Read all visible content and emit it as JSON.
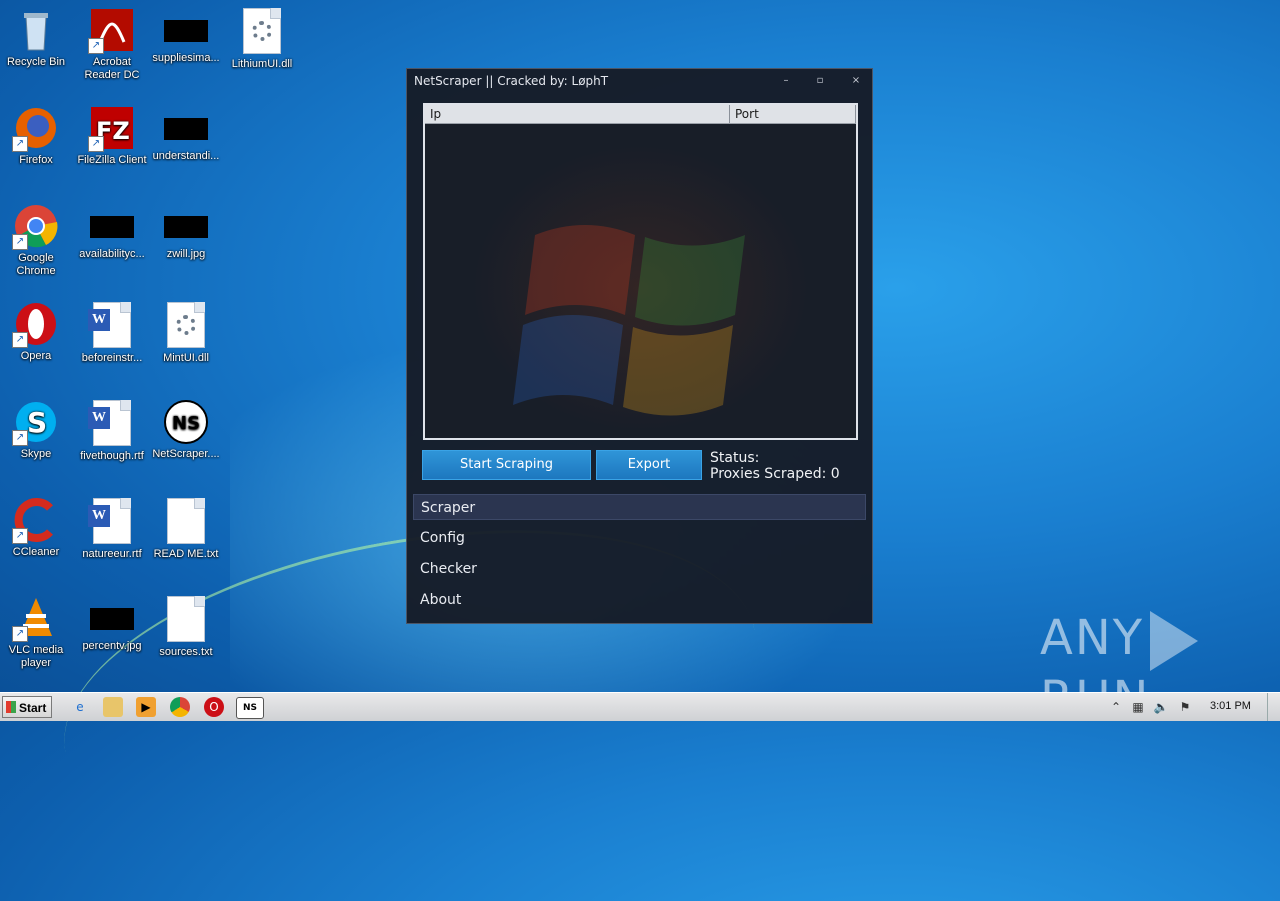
{
  "desktop": {
    "icons": [
      {
        "label": "Recycle Bin",
        "icon": "recycle-bin-icon"
      },
      {
        "label": "Acrobat\nReader DC",
        "icon": "acrobat-icon"
      },
      {
        "label": "suppliesima...",
        "icon": "redacted-image-icon"
      },
      {
        "label": "LithiumUI.dll",
        "icon": "dll-file-icon"
      },
      {
        "label": "Firefox",
        "icon": "firefox-icon"
      },
      {
        "label": "FileZilla Client",
        "icon": "filezilla-icon"
      },
      {
        "label": "understandi...",
        "icon": "redacted-image-icon"
      },
      {
        "label": "Google\nChrome",
        "icon": "chrome-icon"
      },
      {
        "label": "availabilityc...",
        "icon": "redacted-image-icon"
      },
      {
        "label": "zwill.jpg",
        "icon": "redacted-image-icon"
      },
      {
        "label": "Opera",
        "icon": "opera-icon"
      },
      {
        "label": "beforeinstr...",
        "icon": "word-doc-icon"
      },
      {
        "label": "MintUI.dll",
        "icon": "dll-file-icon"
      },
      {
        "label": "Skype",
        "icon": "skype-icon"
      },
      {
        "label": "fivethough.rtf",
        "icon": "word-doc-icon"
      },
      {
        "label": "NetScraper....",
        "icon": "netscraper-icon"
      },
      {
        "label": "CCleaner",
        "icon": "ccleaner-icon"
      },
      {
        "label": "natureeur.rtf",
        "icon": "word-doc-icon"
      },
      {
        "label": "READ ME.txt",
        "icon": "text-file-icon"
      },
      {
        "label": "VLC media\nplayer",
        "icon": "vlc-icon"
      },
      {
        "label": "percentv.jpg",
        "icon": "redacted-image-icon"
      },
      {
        "label": "sources.txt",
        "icon": "text-file-icon"
      }
    ]
  },
  "window": {
    "title": "NetScraper || Cracked by: LøphT",
    "minimize": "–",
    "maximize": "▫",
    "close": "×",
    "table": {
      "columns": [
        "Ip",
        "Port"
      ],
      "rows": []
    },
    "buttons": {
      "start": "Start Scraping",
      "export": "Export"
    },
    "status_label": "Status:",
    "proxies_label": "Proxies Scraped: 0",
    "nav": [
      "Scraper",
      "Config",
      "Checker",
      "About"
    ],
    "active_nav": "Scraper"
  },
  "watermark": {
    "text_left": "ANY",
    "text_right": "RUN"
  },
  "taskbar": {
    "start_label": "Start",
    "pinned": [
      "ie-icon",
      "explorer-icon",
      "media-player-icon",
      "chrome-icon",
      "opera-icon",
      "netscraper-icon"
    ],
    "clock": "3:01 PM"
  },
  "colors": {
    "accent_button": "#2188cf",
    "window_bg": "#161b26",
    "active_nav": "#2b3550"
  }
}
